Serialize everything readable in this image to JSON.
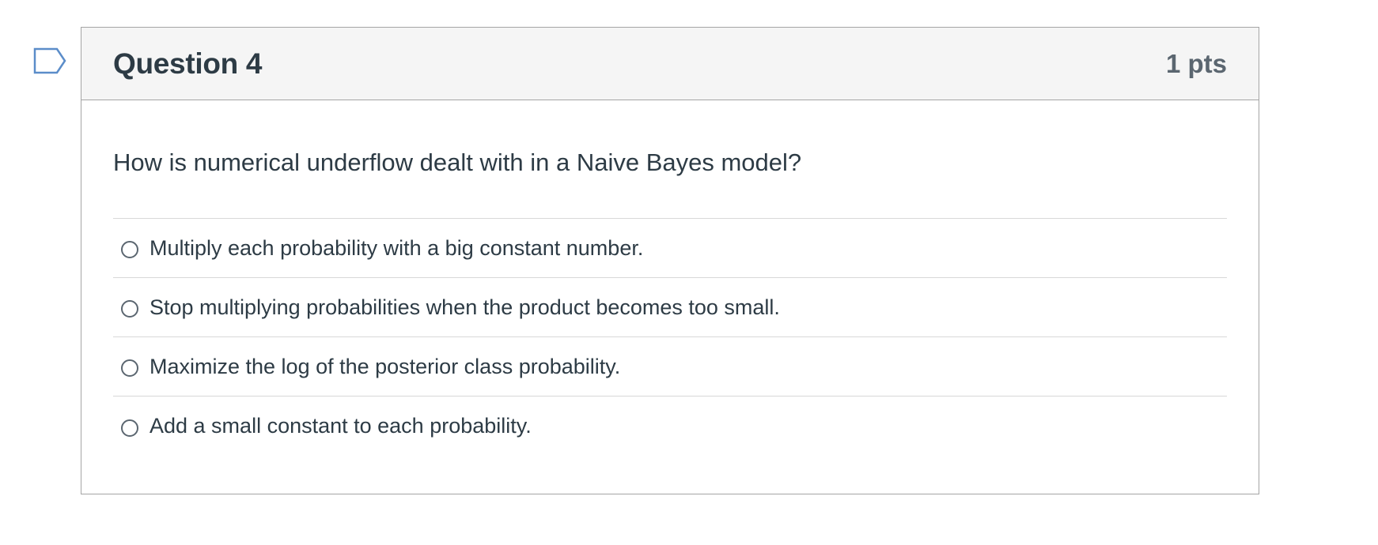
{
  "question": {
    "title": "Question 4",
    "points": "1 pts",
    "text": "How is numerical underflow dealt with in a Naive Bayes model?",
    "answers": [
      {
        "label": "Multiply each probability with a big constant number."
      },
      {
        "label": "Stop multiplying probabilities when the product becomes too small."
      },
      {
        "label": "Maximize the log of the posterior class probability."
      },
      {
        "label": "Add a small constant to each probability."
      }
    ]
  },
  "colors": {
    "flag_outline": "#5b8dc9",
    "header_bg": "#f5f5f5",
    "text": "#2d3b45",
    "border": "#a5a5a5"
  },
  "icons": {
    "flag": "flag-question-icon",
    "radio": "radio-unselected-icon"
  }
}
